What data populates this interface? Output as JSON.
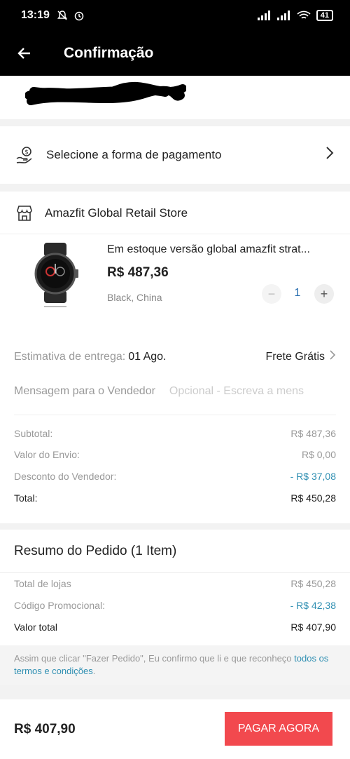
{
  "status_bar": {
    "time": "13:19",
    "battery": "41"
  },
  "app_bar": {
    "title": "Confirmação"
  },
  "payment": {
    "label": "Selecione a forma de pagamento"
  },
  "store": {
    "name": "Amazfit Global Retail Store"
  },
  "product": {
    "title": "Em estoque versão global amazfit strat...",
    "price": "R$ 487,36",
    "variant": "Black, China",
    "quantity": "1",
    "minus": "−",
    "plus": "+"
  },
  "delivery": {
    "label": "Estimativa de entrega:",
    "date": "01 Ago.",
    "shipping": "Frete Grátis"
  },
  "message": {
    "label": "Mensagem para o Vendedor",
    "placeholder": "Opcional - Escreva a mens"
  },
  "store_summary": {
    "subtotal_label": "Subtotal:",
    "subtotal_value": "R$ 487,36",
    "shipping_label": "Valor do Envio:",
    "shipping_value": "R$ 0,00",
    "discount_label": "Desconto do Vendedor:",
    "discount_value": "- R$ 37,08",
    "total_label": "Total:",
    "total_value": "R$ 450,28"
  },
  "order_summary": {
    "title": "Resumo do Pedido (1 Item)",
    "stores_label": "Total de lojas",
    "stores_value": "R$ 450,28",
    "promo_label": "Código Promocional:",
    "promo_value": "- R$ 42,38",
    "total_label": "Valor total",
    "total_value": "R$ 407,90",
    "notice_text": "Assim que clicar \"Fazer Pedido\", Eu confirmo que li e que reconheço ",
    "notice_link": "todos os termos e condições",
    "notice_end": "."
  },
  "footer": {
    "total": "R$ 407,90",
    "pay_button": "PAGAR AGORA"
  },
  "colors": {
    "accent": "#f2494e",
    "link": "#2f8fb2",
    "qty": "#2a6fb0"
  }
}
